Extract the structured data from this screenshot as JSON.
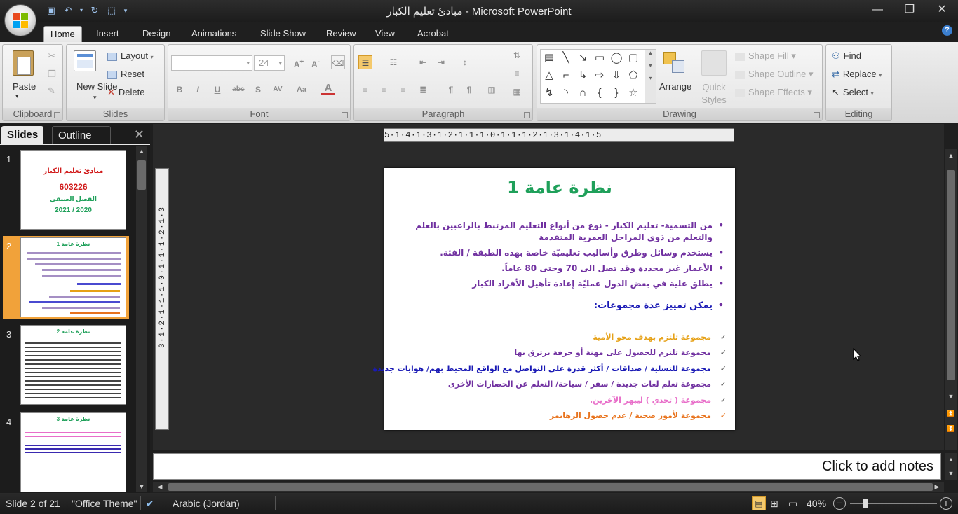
{
  "window": {
    "title": "مبادئ تعليم الكبار - Microsoft PowerPoint",
    "controls": [
      "minimize",
      "restore",
      "close"
    ]
  },
  "ribbon": {
    "tabs": [
      {
        "label": "Home",
        "active": true
      },
      {
        "label": "Insert"
      },
      {
        "label": "Design"
      },
      {
        "label": "Animations"
      },
      {
        "label": "Slide Show"
      },
      {
        "label": "Review"
      },
      {
        "label": "View"
      },
      {
        "label": "Acrobat"
      }
    ],
    "clipboard": {
      "paste": "Paste",
      "group": "Clipboard"
    },
    "slides": {
      "new_slide": "New Slide",
      "layout": "Layout",
      "reset": "Reset",
      "delete": "Delete",
      "group": "Slides"
    },
    "font": {
      "size": "24",
      "group": "Font"
    },
    "paragraph": {
      "group": "Paragraph"
    },
    "drawing": {
      "arrange": "Arrange",
      "quick_styles": "Quick Styles",
      "shape_fill": "Shape Fill",
      "shape_outline": "Shape Outline",
      "shape_effects": "Shape Effects",
      "group": "Drawing"
    },
    "editing": {
      "find": "Find",
      "replace": "Replace",
      "select": "Select",
      "group": "Editing"
    }
  },
  "panel": {
    "tabs": [
      "Slides",
      "Outline"
    ],
    "thumbnails": [
      {
        "number": "1",
        "title": "مبادئ تعليم الكبار",
        "code": "603226",
        "subtitle": "الفصل الصيفي",
        "year": "2021 / 2020"
      },
      {
        "number": "2",
        "title": "نظرة عامة 1",
        "selected": true
      },
      {
        "number": "3",
        "title": "نظرة عامة 2"
      },
      {
        "number": "4",
        "title": "نظرة عامة 3"
      }
    ]
  },
  "ruler": {
    "horizontal": "5·1·4·1·3·1·2·1·1·1·0·1·1·1·2·1·3·1·4·1·5",
    "vertical": "3·1·2·1·1·1·0·1·1·1·2·1·3"
  },
  "slide": {
    "title": "نظرة عامة 1",
    "bullets": [
      {
        "text": "من التسمية- تعليم الكبار - نوع من أنواع التعليم المرتبط بالراغبين بالعلم والتعلم من ذوي المراحل العمرية المتقدمة",
        "color": "#7030a0"
      },
      {
        "text": "يستخدم وسائل وطرق وأساليب تعليميّة خاصة بهذه الطبقة / الفئة.",
        "color": "#7030a0"
      },
      {
        "text": "الأعمار غير محددة وقد تصل الى  70  وحتى 80 عاماً.",
        "color": "#7030a0"
      },
      {
        "text": "يطلق علية في بعض الدول عمليّة إعادة تأهيل الأفراد الكبار",
        "color": "#7030a0"
      }
    ],
    "groups_heading": "يمكن تمييز عدة مجموعات:",
    "groups": [
      {
        "text": "مجموعة تلتزم بهدف محو الأمية",
        "color": "#e6a117"
      },
      {
        "text": "مجموعة تلتزم للحصول على مهنة أو حرفة يرتزق بها",
        "color": "#7030a0"
      },
      {
        "text": "مجموعة للتسلية / صداقات / أكثر قدرة على التواصل مع الواقع المحيط بهم/ هوايات جديدة",
        "color": "#1a1ab5"
      },
      {
        "text": "مجموعة تعلم لغات جديدة / سفر / سياحة/ التعلم عن الحضارات الأخرى",
        "color": "#7030a0"
      },
      {
        "text": "مجموعة ( تحدي ) ليبهر الآخرين.",
        "color": "#e86ec9"
      },
      {
        "text": "مجموعة لأمور صحية / عدم حصول الزهايمر",
        "color": "#e8731d"
      }
    ]
  },
  "notes": {
    "placeholder": "Click to add notes"
  },
  "statusbar": {
    "slide_info": "Slide 2 of 21",
    "theme": "\"Office Theme\"",
    "language": "Arabic (Jordan)",
    "zoom": "40%"
  },
  "colors": {
    "accent_green": "#1fa05a",
    "selected_thumb": "#f1a23a"
  }
}
